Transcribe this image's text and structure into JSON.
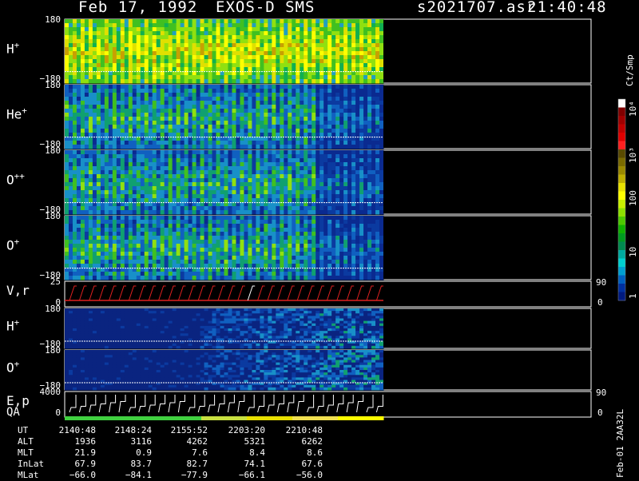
{
  "header": {
    "date": "Feb 17, 1992",
    "instrument": "EXOS-D SMS",
    "file": "s2021707.asr",
    "time": "21:40:48"
  },
  "panels": [
    {
      "label": "H",
      "sup": "+",
      "tick_top": "180",
      "tick_bottom": "−180",
      "kind": "spec",
      "theme": "hot"
    },
    {
      "label": "He",
      "sup": "+",
      "tick_top": "180",
      "tick_bottom": "−180",
      "kind": "spec",
      "theme": "mid"
    },
    {
      "label": "O",
      "sup": "++",
      "tick_top": "180",
      "tick_bottom": "−180",
      "kind": "spec",
      "theme": "mid"
    },
    {
      "label": "O",
      "sup": "+",
      "tick_top": "180",
      "tick_bottom": "−180",
      "kind": "spec",
      "theme": "mid"
    },
    {
      "label": "V,r",
      "sup": "",
      "tick_top": "25",
      "tick_bottom": "0",
      "kind": "vr",
      "right_top": "90",
      "right_bottom": "0"
    },
    {
      "label": "H",
      "sup": "+",
      "tick_top": "180",
      "tick_bottom": "−180",
      "kind": "spec",
      "theme": "low"
    },
    {
      "label": "O",
      "sup": "+",
      "tick_top": "180",
      "tick_bottom": "−180",
      "kind": "spec",
      "theme": "low2"
    },
    {
      "label": "E,p",
      "sup": "",
      "label2": "QA",
      "tick_top": "4000",
      "tick_bottom": "0",
      "kind": "ep",
      "right_top": "90",
      "right_bottom": "0"
    }
  ],
  "colorbar": {
    "unit": "Ct/Smp",
    "labels": [
      "10⁴",
      "10³",
      "100",
      "10",
      "1"
    ],
    "colors": [
      "#ffffff",
      "#800000",
      "#a00000",
      "#c00000",
      "#e00000",
      "#ff2020",
      "#5a4a00",
      "#7a6a00",
      "#9a8800",
      "#bfae00",
      "#e8e000",
      "#ffff00",
      "#c8f000",
      "#8ee000",
      "#4ec800",
      "#10b000",
      "#009a20",
      "#008a50",
      "#00aaa0",
      "#00d0d0",
      "#00a0d0",
      "#0060c0",
      "#0030a0",
      "#001a80"
    ]
  },
  "footer": {
    "rows": [
      {
        "label": "UT",
        "values": [
          "2140:48",
          "2148:24",
          "2155:52",
          "2203:20",
          "2210:48"
        ]
      },
      {
        "label": "ALT",
        "values": [
          "1936",
          "3116",
          "4262",
          "5321",
          "6262"
        ]
      },
      {
        "label": "MLT",
        "values": [
          "21.9",
          "0.9",
          "7.6",
          "8.4",
          "8.6"
        ]
      },
      {
        "label": "InLat",
        "values": [
          "67.9",
          "83.7",
          "82.7",
          "74.1",
          "67.6"
        ]
      },
      {
        "label": "MLat",
        "values": [
          "−66.0",
          "−84.1",
          "−77.9",
          "−66.1",
          "−56.0"
        ]
      }
    ],
    "code": "Feb-01 2AA32L"
  }
}
